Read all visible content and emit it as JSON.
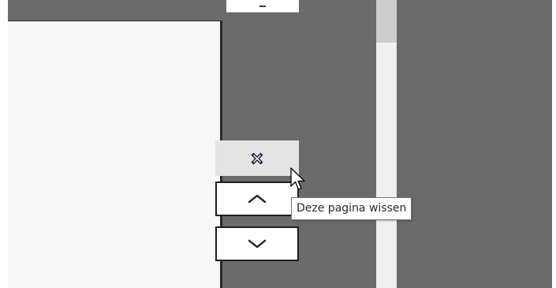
{
  "tooltip": {
    "text": "Deze pagina wissen"
  },
  "buttons": {
    "delete": {
      "icon": "close-icon"
    },
    "move_up": {
      "icon": "chevron-up-icon"
    },
    "move_down": {
      "icon": "chevron-down-icon"
    }
  },
  "colors": {
    "canvas_background": "#6b6b6b",
    "page_background": "#f8f8f8",
    "icon_color": "#1b1b3a",
    "delete_button_background": "#e4e4e4",
    "scrollbar_track": "#f0f0f0",
    "scrollbar_thumb": "#cdcdcd"
  }
}
